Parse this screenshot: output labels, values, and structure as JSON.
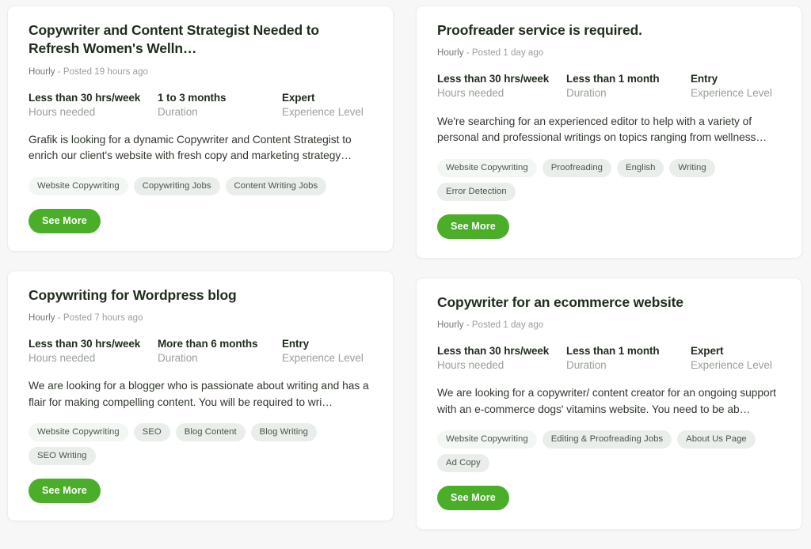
{
  "page": {
    "background_color": "#f7f7f7",
    "accent_color": "#4aae29",
    "layout": "two-column-job-card-grid"
  },
  "labels": {
    "hours_needed": "Hours needed",
    "duration": "Duration",
    "experience_level": "Experience Level",
    "see_more": "See More"
  },
  "columns": {
    "left": [
      {
        "title": "Copywriter and Content Strategist Needed to Refresh Women's Welln…",
        "payment_type": "Hourly",
        "posted": "- Posted 19 hours ago",
        "hours": "Less than 30 hrs/week",
        "duration": "1 to 3 months",
        "experience": "Expert",
        "description": "Grafik is looking for a dynamic Copywriter and Content Strategist to enrich our client's website with fresh copy and marketing strategy…",
        "tags": [
          "Website Copywriting",
          "Copywriting Jobs",
          "Content Writing Jobs"
        ],
        "button": "See More"
      },
      {
        "title": "Copywriting for Wordpress blog",
        "payment_type": "Hourly",
        "posted": "- Posted 7 hours ago",
        "hours": "Less than 30 hrs/week",
        "duration": "More than 6 months",
        "experience": "Entry",
        "description": "We are looking for a blogger who is passionate about writing and has a flair for making compelling content. You will be required to wri…",
        "tags": [
          "Website Copywriting",
          "SEO",
          "Blog Content",
          "Blog Writing",
          "SEO Writing"
        ],
        "button": "See More"
      }
    ],
    "right": [
      {
        "title": "Proofreader service is required.",
        "payment_type": "Hourly",
        "posted": "- Posted 1 day ago",
        "hours": "Less than 30 hrs/week",
        "duration": "Less than 1 month",
        "experience": "Entry",
        "description": "We're searching for an experienced editor to help with a variety of personal and professional writings on topics ranging from wellness…",
        "tags": [
          "Website Copywriting",
          "Proofreading",
          "English",
          "Writing",
          "Error Detection"
        ],
        "button": "See More"
      },
      {
        "title": "Copywriter for an ecommerce website",
        "payment_type": "Hourly",
        "posted": "- Posted 1 day ago",
        "hours": "Less than 30 hrs/week",
        "duration": "Less than 1 month",
        "experience": "Expert",
        "description": "We are looking for a copywriter/ content creator for an ongoing support with an e-commerce dogs' vitamins website. You need to be ab…",
        "tags": [
          "Website Copywriting",
          "Editing & Proofreading Jobs",
          "About Us Page",
          "Ad Copy"
        ],
        "button": "See More"
      }
    ]
  }
}
